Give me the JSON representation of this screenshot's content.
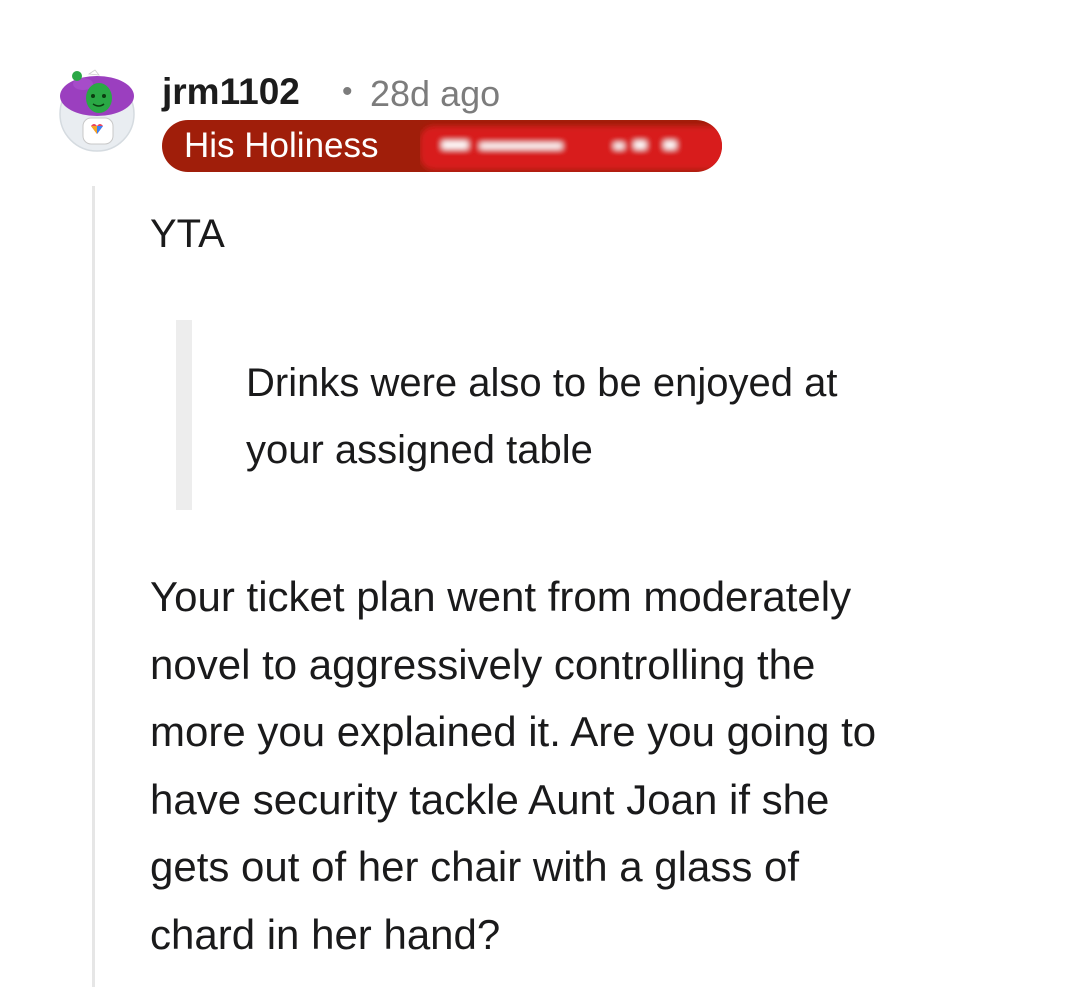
{
  "comment": {
    "author": "jrm1102",
    "separator": "•",
    "timestamp": "28d ago",
    "flair": {
      "text": "His Holiness",
      "color": "#a01e0a",
      "redacted_suffix": true
    },
    "verdict": "YTA",
    "quote_lines": [
      "Drinks were also to be enjoyed at",
      "your assigned table"
    ],
    "body_lines": [
      "Your ticket plan went from moderately",
      "novel to aggressively controlling the",
      "more you explained it. Are you going to",
      "have security tackle Aunt Joan if she",
      "gets out of her chair with a glass of",
      "chard in her hand?"
    ]
  },
  "avatar": {
    "icon": "snoo-avatar-icon",
    "hair_color": "#9b3fbf",
    "face_color": "#2aa845"
  }
}
